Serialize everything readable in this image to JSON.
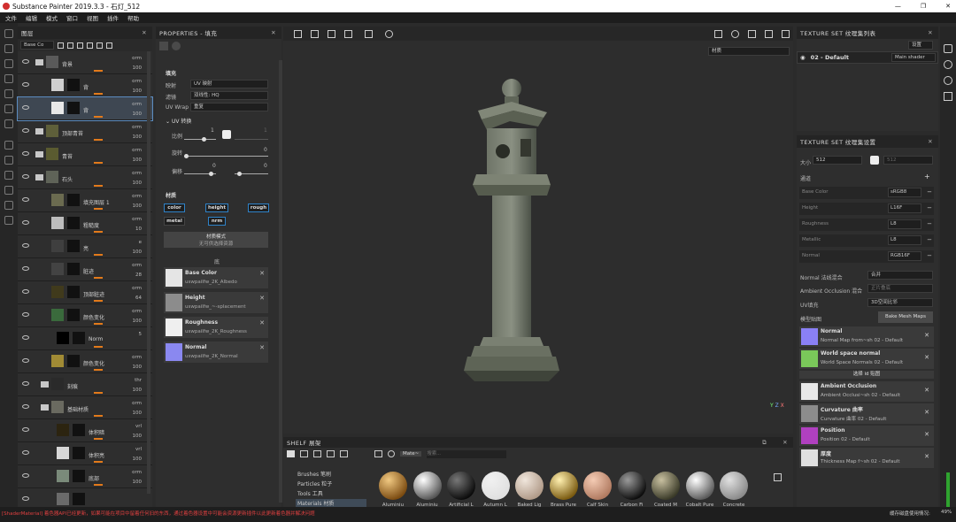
{
  "window": {
    "title": "Substance Painter 2019.3.3 - 石灯_512",
    "controls": [
      "—",
      "❐",
      "✕"
    ]
  },
  "menu": [
    "文件",
    "编辑",
    "模式",
    "窗口",
    "视图",
    "插件",
    "帮助"
  ],
  "layers": {
    "header": "图层",
    "blend_default": "Base Co",
    "rows": [
      {
        "name": "背景",
        "mode": "orm",
        "pct": "100",
        "kind": "folder",
        "indent": 0,
        "color": "#5a5a5a"
      },
      {
        "name": "背",
        "mode": "orm",
        "pct": "100",
        "kind": "layer",
        "indent": 1,
        "color": "#cfcfcf"
      },
      {
        "name": "背",
        "mode": "orm",
        "pct": "100",
        "kind": "layer",
        "indent": 1,
        "color": "#e8e8e8",
        "selected": true
      },
      {
        "name": "顶部青苔",
        "mode": "orm",
        "pct": "100",
        "kind": "folder",
        "indent": 0,
        "color": "#5e5f3a"
      },
      {
        "name": "青苔",
        "mode": "orm",
        "pct": "100",
        "kind": "folder",
        "indent": 0,
        "color": "#5a5b30"
      },
      {
        "name": "石头",
        "mode": "orm",
        "pct": "100",
        "kind": "folder",
        "indent": 0,
        "color": "#5f6358"
      },
      {
        "name": "填充图层 1",
        "mode": "orm",
        "pct": "100",
        "kind": "layer",
        "indent": 1,
        "color": "#6b6b50"
      },
      {
        "name": "粗糙度",
        "mode": "orm",
        "pct": "10",
        "kind": "layer",
        "indent": 1,
        "color": "#bdbdbd"
      },
      {
        "name": "亮",
        "mode": "e",
        "pct": "100",
        "kind": "layer",
        "indent": 1,
        "color": "#3f3f3f"
      },
      {
        "name": "脏迹",
        "mode": "orm",
        "pct": "28",
        "kind": "layer",
        "indent": 1,
        "color": "#434343"
      },
      {
        "name": "顶部脏迹",
        "mode": "orm",
        "pct": "64",
        "kind": "layer",
        "indent": 1,
        "color": "#403a1c"
      },
      {
        "name": "颜色变化",
        "mode": "orm",
        "pct": "100",
        "kind": "layer",
        "indent": 1,
        "color": "#3a6a3c"
      },
      {
        "name": "Norm",
        "mode": "",
        "pct": "5",
        "kind": "sub",
        "indent": 2,
        "color": "#000"
      },
      {
        "name": "颜色变化",
        "mode": "orm",
        "pct": "100",
        "kind": "layer",
        "indent": 1,
        "color": "#a18b35"
      },
      {
        "name": "刻痕",
        "mode": "thr",
        "pct": "100",
        "kind": "folder",
        "indent": 1,
        "color": "#2a2a2a"
      },
      {
        "name": "基础材质",
        "mode": "orm",
        "pct": "100",
        "kind": "folder",
        "indent": 1,
        "color": "#6a6a60"
      },
      {
        "name": "体积暗",
        "mode": "vrl",
        "pct": "100",
        "kind": "layer",
        "indent": 2,
        "color": "#2c2410"
      },
      {
        "name": "体积亮",
        "mode": "vrl",
        "pct": "100",
        "kind": "layer",
        "indent": 2,
        "color": "#d8d8d8"
      },
      {
        "name": "底部",
        "mode": "orm",
        "pct": "100",
        "kind": "layer",
        "indent": 2,
        "color": "#7a8a7a"
      },
      {
        "name": "",
        "mode": "",
        "pct": "",
        "kind": "layer",
        "indent": 2,
        "color": "#6a6a6a"
      }
    ]
  },
  "properties": {
    "header": "PROPERTIES - 填充",
    "fill_title": "填充",
    "projection_label": "映射",
    "projection_value": "UV 映射",
    "filter_label": "滤镜",
    "filter_value": "双线性: HQ",
    "uvwrap_label": "UV Wrap",
    "uvwrap_value": "重复",
    "uv_transform": "UV 转换",
    "scale_label": "比例",
    "scale_value": "1",
    "scale_value2": "1",
    "rotation_label": "旋转",
    "rotation_value": "0",
    "offset_label": "偏移",
    "offset_value": "0",
    "offset_value2": "0",
    "material_title": "材质",
    "channels": [
      "color",
      "height",
      "rough",
      "metal",
      "nrm"
    ],
    "material_mode": "材质模式",
    "material_mode_sub": "无可供选择资源",
    "maps_title": "底",
    "maps": [
      {
        "name": "Base Color",
        "file": "uswpaiIfw_2K_Albedo",
        "color": "#e5e5e5"
      },
      {
        "name": "Height",
        "file": "uswpaiIfw_~-splacement",
        "color": "#8c8c8c"
      },
      {
        "name": "Roughness",
        "file": "uswpaiIfw_2K_Roughness",
        "color": "#efefef"
      },
      {
        "name": "Normal",
        "file": "uswpaiIfw_2K_Normal",
        "color": "#8a88f0"
      }
    ]
  },
  "viewport": {
    "dropdown": "材质",
    "axis_y": "Y",
    "axis_z": "Z",
    "axis_x": "X"
  },
  "texset_list": {
    "header": "TEXTURE SET 纹理集列表",
    "settings_btn": "设置",
    "item": "02 - Default",
    "shader": "Main shader"
  },
  "texset_settings": {
    "header": "TEXTURE SET 纹理集设置",
    "size_label": "大小",
    "size_value": "512",
    "size_value2": "512",
    "channels_label": "通道",
    "channels": [
      {
        "name": "Base Color",
        "fmt": "sRGB8"
      },
      {
        "name": "Height",
        "fmt": "L16F"
      },
      {
        "name": "Roughness",
        "fmt": "L8"
      },
      {
        "name": "Metallic",
        "fmt": "L8"
      },
      {
        "name": "Normal",
        "fmt": "RGB16F"
      }
    ],
    "normal_mix_label": "Normal 法线混合",
    "normal_mix_value": "合并",
    "ao_mix_label": "Ambient Occlusion 混合",
    "ao_mix_value": "正片叠底",
    "uv_pad_label": "UV填充",
    "uv_pad_value": "3D空间比邻",
    "model_maps_label": "模型贴图",
    "bake_btn": "Bake Mesh Maps",
    "maps": [
      {
        "title": "Normal",
        "sub": "Normal Map from~sh 02 - Default",
        "color": "#8a80f5"
      },
      {
        "title": "World space normal",
        "sub": "World Space Normals 02 - Default",
        "color": "#7ac85a"
      },
      {
        "title": "选择 id 贴图",
        "sub": "",
        "color": ""
      },
      {
        "title": "Ambient Occlusion",
        "sub": "Ambient Occlusi~sh 02 - Default",
        "color": "#e8e8e8"
      },
      {
        "title": "Curvature 曲率",
        "sub": "Curvature 曲率 02 - Default",
        "color": "#8c8c8c"
      },
      {
        "title": "Position",
        "sub": "Position 02 - Default",
        "color": "#b040c0"
      },
      {
        "title": "厚度",
        "sub": "Thickness Map f~sh 02 - Default",
        "color": "#e0e0e0"
      }
    ]
  },
  "shelf": {
    "header": "SHELF 展架",
    "filter_chip": "Mate~",
    "search_placeholder": "搜索...",
    "categories": [
      "Brushes 笔刷",
      "Particles 粒子",
      "Tools 工具",
      "Materials 材质"
    ],
    "materials": [
      {
        "name": "Aluminiu",
        "c1": "#f1c982",
        "c2": "#7a4a10"
      },
      {
        "name": "Aluminiu",
        "c1": "#ffffff",
        "c2": "#555555"
      },
      {
        "name": "Artificial L",
        "c1": "#777777",
        "c2": "#0b0b0b"
      },
      {
        "name": "Autumn L",
        "c1": "#f0f0f0",
        "c2": "#e0e0e0"
      },
      {
        "name": "Baked Lig",
        "c1": "#f0e6dc",
        "c2": "#b09a88"
      },
      {
        "name": "Brass Pure",
        "c1": "#fff0b0",
        "c2": "#7a5a10"
      },
      {
        "name": "Calf Skin",
        "c1": "#f4cbb4",
        "c2": "#b07a60"
      },
      {
        "name": "Carbon Fi",
        "c1": "#9a9a9a",
        "c2": "#0d0d0d"
      },
      {
        "name": "Coated M",
        "c1": "#c8c0a0",
        "c2": "#3a3a28"
      },
      {
        "name": "Cobalt Pure",
        "c1": "#ffffff",
        "c2": "#5a5a5a"
      },
      {
        "name": "Concrete",
        "c1": "#e0e0e0",
        "c2": "#8a8a8a"
      }
    ]
  },
  "status": {
    "error": "[ShaderMaterial] 着色器API已经更新，如果可能在项目中留着任何旧的东西，通过着色器设置中可能会资源更新插件以此更新着色器并解决问题",
    "right": "缓存磁盘使用情况:",
    "pct": "49%"
  }
}
